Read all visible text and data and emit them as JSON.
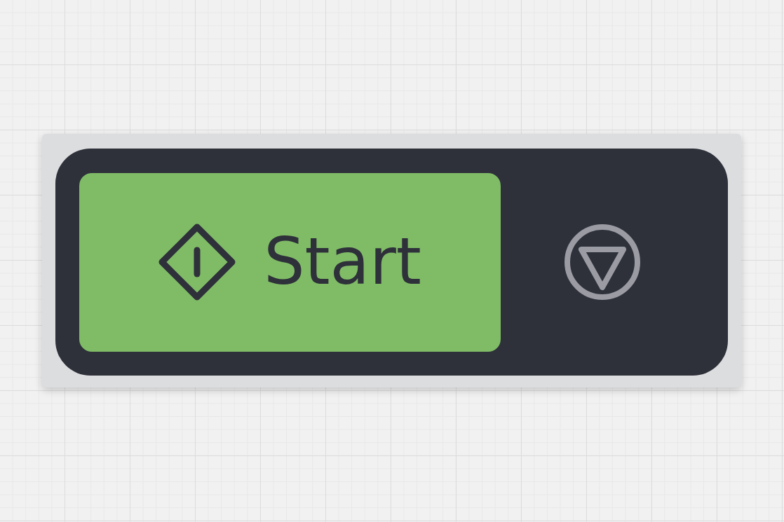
{
  "control_panel": {
    "buttons": [
      {
        "kind": "start",
        "label": "Start",
        "active": true
      },
      {
        "kind": "stop",
        "active": false
      }
    ]
  }
}
